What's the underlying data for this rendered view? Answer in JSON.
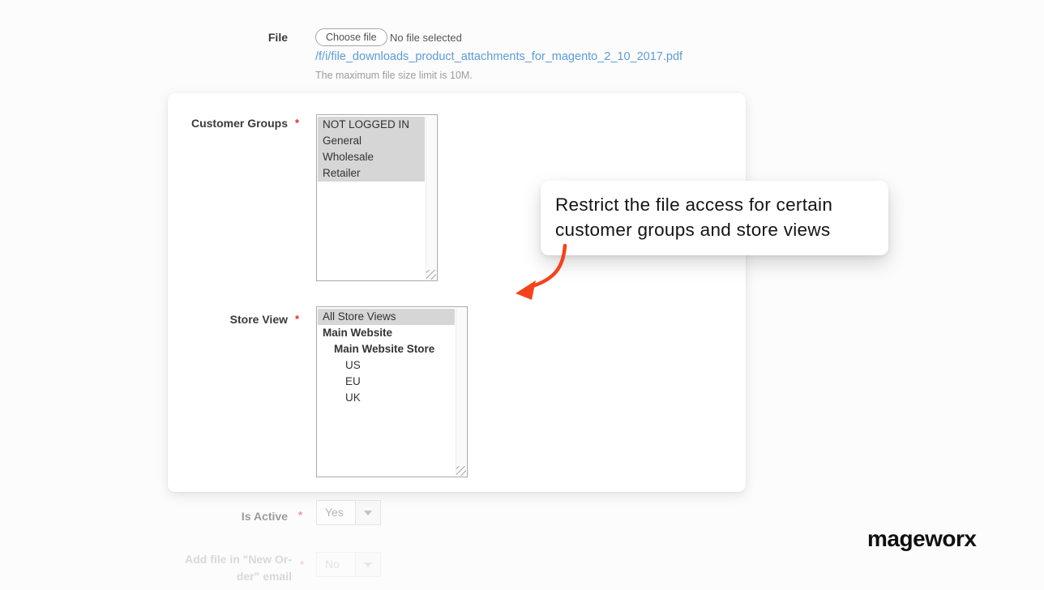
{
  "colors": {
    "link_blue": "#5c9cd7",
    "required_red": "#e02b27",
    "arrow_orange": "#f4431c",
    "selection_gray": "#d6d6d6"
  },
  "file_field": {
    "label": "File",
    "choose_button_label": "Choose file",
    "no_file_text": "No file selected",
    "file_link": "/f/i/file_downloads_product_attachments_for_magento_2_10_2017.pdf",
    "note": "The maximum file size limit is 10M."
  },
  "card": {
    "customer_groups": {
      "label": "Customer Groups",
      "required_mark": "*",
      "options": [
        {
          "label": "NOT LOGGED IN",
          "selected": true,
          "indent": 0
        },
        {
          "label": "General",
          "selected": true,
          "indent": 0
        },
        {
          "label": "Wholesale",
          "selected": true,
          "indent": 0
        },
        {
          "label": "Retailer",
          "selected": true,
          "indent": 0
        }
      ]
    },
    "store_view": {
      "label": "Store View",
      "required_mark": "*",
      "options": [
        {
          "label": "All Store Views",
          "selected": true,
          "indent": 0
        },
        {
          "label": "Main Website",
          "bold": true,
          "indent": 0
        },
        {
          "label": "Main Website Store",
          "bold": true,
          "indent": 1
        },
        {
          "label": "US",
          "indent": 2
        },
        {
          "label": "EU",
          "indent": 2
        },
        {
          "label": "UK",
          "indent": 2
        }
      ]
    }
  },
  "callout": {
    "text": "Restrict the file access for certain customer groups and store views"
  },
  "dimmed_fields": {
    "is_active": {
      "label": "Is Active",
      "required_mark": "*",
      "value": "Yes"
    },
    "add_file_email": {
      "label_line1": "Add file in \"New Or-",
      "label_line2": "der\" email",
      "required_mark": "*",
      "value": "No"
    }
  },
  "footer": {
    "logo_text": "mageworx"
  }
}
